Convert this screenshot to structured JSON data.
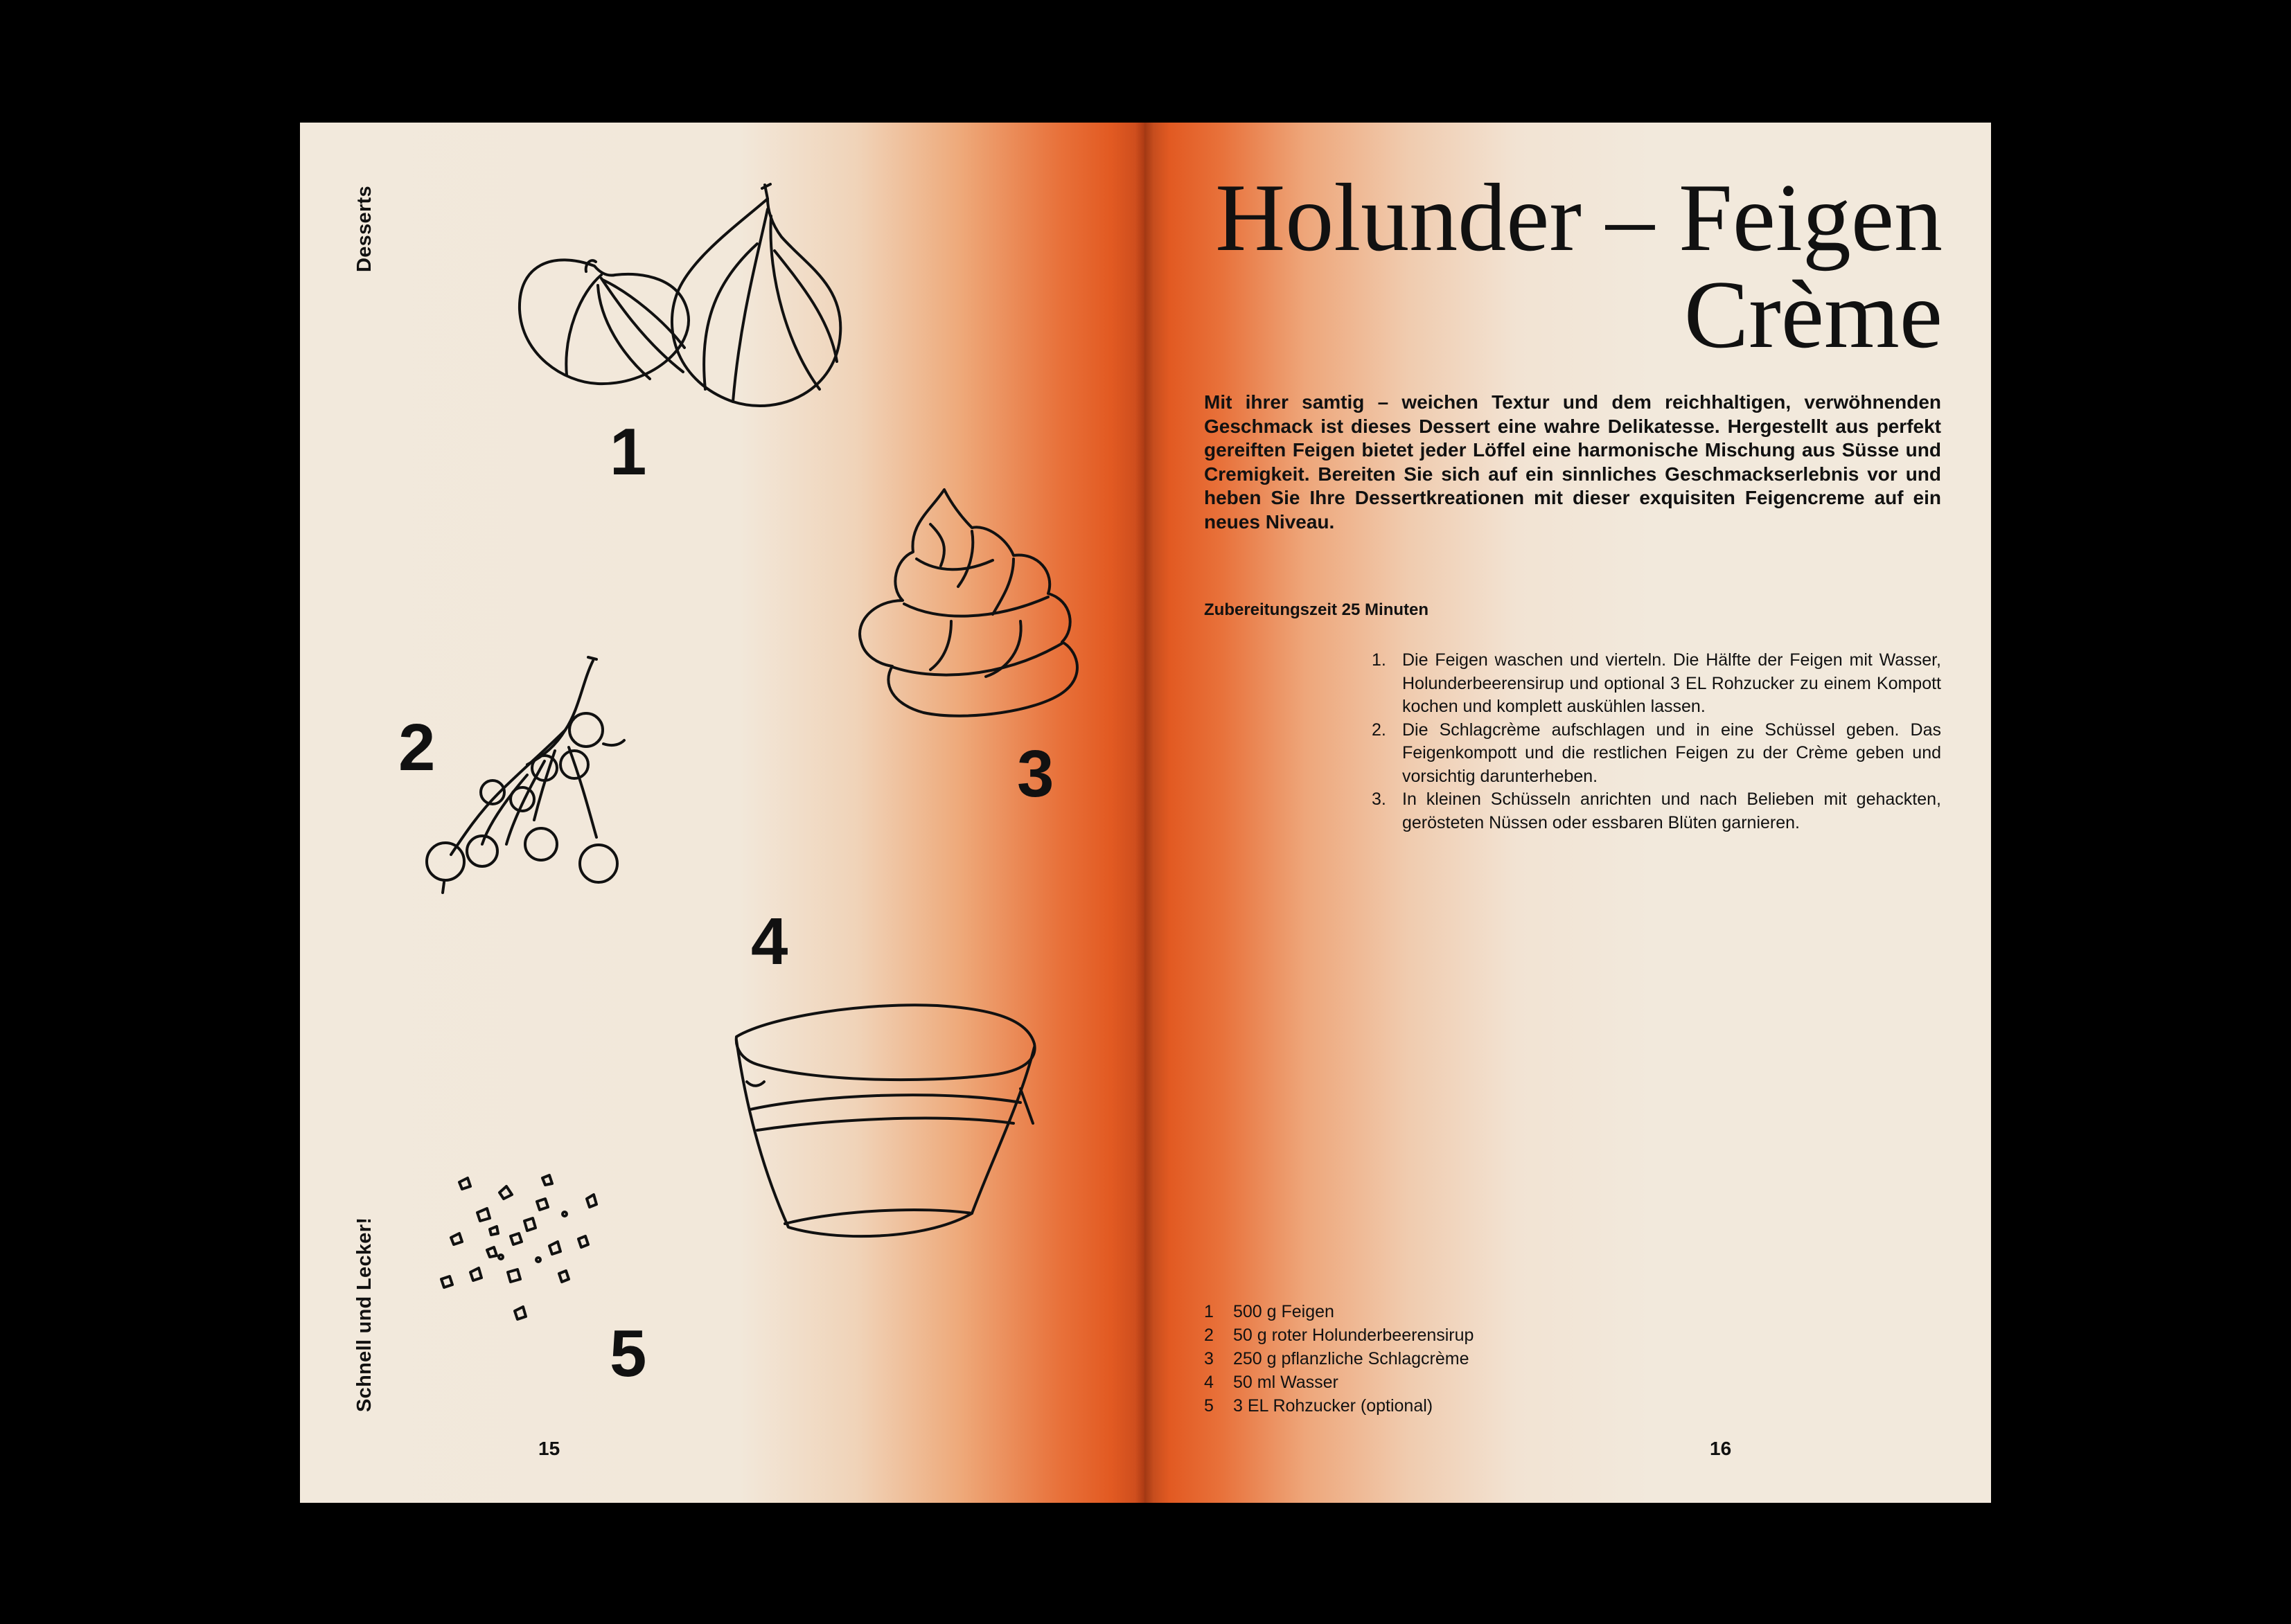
{
  "left_page": {
    "section_label": "Desserts",
    "footer_label": "Schnell und Lecker!",
    "page_number": "15",
    "illustration_numbers": [
      "1",
      "2",
      "3",
      "4",
      "5"
    ]
  },
  "right_page": {
    "title_line1": "Holunder – Feigen",
    "title_line2": "Crème",
    "intro": "Mit ihrer samtig – weichen Textur und dem reichhaltigen, verwöhnenden Geschmack ist dieses Dessert eine wahre Delikatesse. Hergestellt aus perfekt gereiften Feigen bietet jeder Löffel eine harmonische Mischung aus Süsse und Cremigkeit. Bereiten Sie sich auf ein sinnliches Geschmackserlebnis vor und heben Sie Ihre Dessertkreationen mit dieser exquisiten Feigencreme auf ein neues Niveau.",
    "prep_time": "Zubereitungszeit 25 Minuten",
    "steps": [
      {
        "num": "1.",
        "text": "Die Feigen waschen und vierteln. Die Hälfte der Feigen mit Wasser, Holunderbeerensirup und optional 3 EL Rohzucker zu einem Kompott kochen und komplett auskühlen lassen."
      },
      {
        "num": "2.",
        "text": "Die Schlagcrème aufschlagen und in eine Schüssel geben. Das Feigenkompott und die restlichen Feigen zu der Crème geben und vorsichtig darunterheben."
      },
      {
        "num": "3.",
        "text": "In kleinen Schüsseln anrichten und nach Belieben mit gehackten, gerösteten Nüssen oder essbaren Blüten garnieren."
      }
    ],
    "ingredients": [
      {
        "num": "1",
        "text": "500 g Feigen"
      },
      {
        "num": "2",
        "text": "50 g roter Holunderbeerensirup"
      },
      {
        "num": "3",
        "text": "250 g pflanzliche Schlagcrème"
      },
      {
        "num": "4",
        "text": "50 ml Wasser"
      },
      {
        "num": "5",
        "text": "3 EL Rohzucker (optional)"
      }
    ],
    "page_number": "16"
  },
  "colors": {
    "background": "#000000",
    "paper": "#f2e9dc",
    "accent_orange": "#e25a22",
    "ink": "#111111"
  },
  "icons": [
    "figs-sketch",
    "elderberry-sprig-sketch",
    "whipped-cream-sketch",
    "bowl-sketch",
    "chopped-nuts-sketch"
  ]
}
